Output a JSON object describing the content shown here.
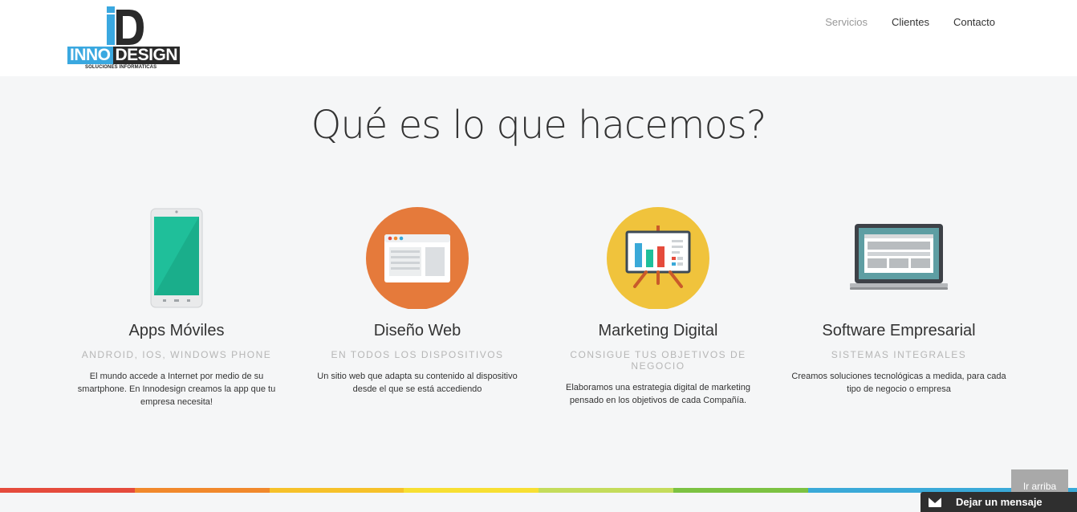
{
  "header": {
    "logo": {
      "word1": "INNO",
      "word2": "DESIGN",
      "subtitle": "SOLUCIONES INFORMATICAS",
      "mark": "iD"
    },
    "nav": [
      {
        "label": "Servicios",
        "active": true
      },
      {
        "label": "Clientes",
        "active": false
      },
      {
        "label": "Contacto",
        "active": false
      }
    ]
  },
  "hero": {
    "title": "Qué es lo que hacemos?"
  },
  "services": [
    {
      "icon": "smartphone-icon",
      "name": "Apps Móviles",
      "tagline": "ANDROID, IOS, WINDOWS PHONE",
      "description": "El mundo accede a Internet por medio de su smartphone. En Innodesign creamos la app que tu empresa necesita!"
    },
    {
      "icon": "browser-window-icon",
      "name": "Diseño Web",
      "tagline": "EN TODOS LOS DISPOSITIVOS",
      "description": "Un sitio web que adapta su contenido al dispositivo desde el que se está accediendo"
    },
    {
      "icon": "presentation-chart-icon",
      "name": "Marketing Digital",
      "tagline": "CONSIGUE TUS OBJETIVOS DE NEGOCIO",
      "description": "Elaboramos una estrategia digital de marketing pensado en los objetivos de cada Compañía."
    },
    {
      "icon": "laptop-icon",
      "name": "Software Empresarial",
      "tagline": "SISTEMAS INTEGRALES",
      "description": "Creamos soluciones tecnológicas a medida, para cada tipo de negocio o empresa"
    }
  ],
  "colors": {
    "stripe": [
      "#e54b3c",
      "#f1892c",
      "#f6c12a",
      "#f7df33",
      "#c4dc5b",
      "#7cc242",
      "#3aa9d8",
      "#3aa9d8"
    ],
    "logo_blue": "#3aa8e0",
    "logo_dark": "#2a2a2a"
  },
  "footer": {
    "scroll_top_label": "Ir arriba",
    "message_label": "Dejar un mensaje"
  }
}
